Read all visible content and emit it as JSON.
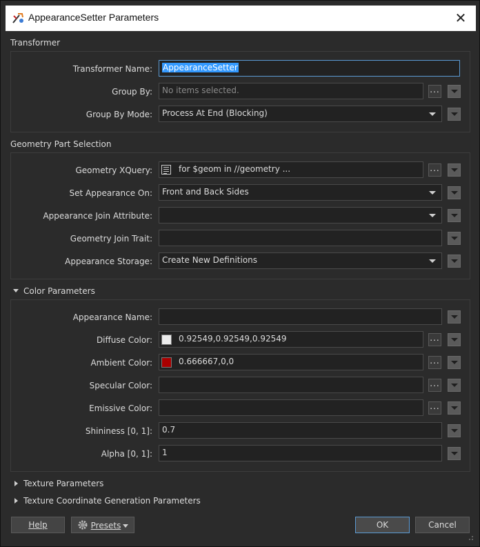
{
  "window": {
    "title": "AppearanceSetter Parameters",
    "close_glyph": "✕"
  },
  "transformer": {
    "section_label": "Transformer",
    "name_label": "Transformer Name:",
    "name_value": "AppearanceSetter",
    "group_by_label": "Group By:",
    "group_by_placeholder": "No items selected.",
    "group_by_mode_label": "Group By Mode:",
    "group_by_mode_value": "Process At End (Blocking)"
  },
  "geometry": {
    "section_label": "Geometry Part Selection",
    "xquery_label": "Geometry XQuery:",
    "xquery_value": "for $geom in //geometry ...",
    "set_appearance_label": "Set Appearance On:",
    "set_appearance_value": "Front and Back Sides",
    "join_attr_label": "Appearance Join Attribute:",
    "join_attr_value": "",
    "join_trait_label": "Geometry Join Trait:",
    "join_trait_value": "",
    "storage_label": "Appearance Storage:",
    "storage_value": "Create New Definitions"
  },
  "color": {
    "section_label": "Color Parameters",
    "appearance_name_label": "Appearance Name:",
    "appearance_name_value": "",
    "diffuse_label": "Diffuse Color:",
    "diffuse_value": "0.92549,0.92549,0.92549",
    "diffuse_swatch": "#ececec",
    "ambient_label": "Ambient Color:",
    "ambient_value": "0.666667,0,0",
    "ambient_swatch": "#aa0000",
    "specular_label": "Specular Color:",
    "specular_value": "",
    "emissive_label": "Emissive Color:",
    "emissive_value": "",
    "shininess_label": "Shininess [0, 1]:",
    "shininess_value": "0.7",
    "alpha_label": "Alpha [0, 1]:",
    "alpha_value": "1"
  },
  "collapsed_sections": {
    "texture": "Texture Parameters",
    "texture_coord": "Texture Coordinate Generation Parameters"
  },
  "footer": {
    "help_label": "Help",
    "presets_label": "Presets",
    "ok_label": "OK",
    "cancel_label": "Cancel"
  },
  "colors": {
    "accent": "#5b9bd5",
    "selection": "#3399ff",
    "background": "#2b2b2b"
  }
}
